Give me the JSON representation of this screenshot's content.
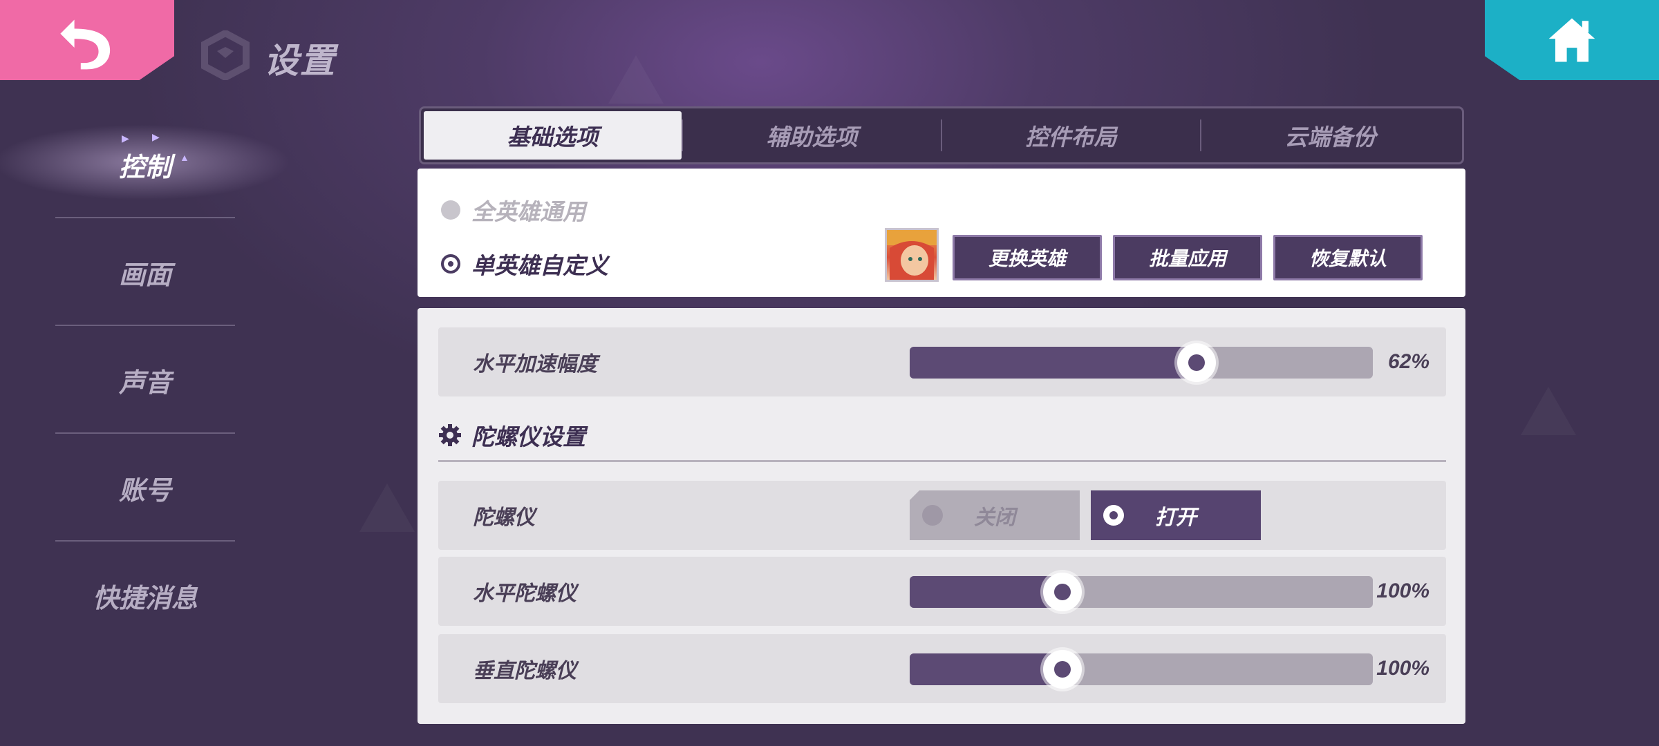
{
  "header": {
    "title": "设置",
    "back_icon": "back-arrow-icon",
    "home_icon": "home-icon",
    "colors": {
      "back": "#f06aa6",
      "home": "#1cb0c6"
    }
  },
  "nav": {
    "items": [
      {
        "label": "控制",
        "active": true
      },
      {
        "label": "画面",
        "active": false
      },
      {
        "label": "声音",
        "active": false
      },
      {
        "label": "账号",
        "active": false
      },
      {
        "label": "快捷消息",
        "active": false
      }
    ]
  },
  "tabs": [
    {
      "label": "基础选项",
      "active": true
    },
    {
      "label": "辅助选项",
      "active": false
    },
    {
      "label": "控件布局",
      "active": false
    },
    {
      "label": "云端备份",
      "active": false
    }
  ],
  "hero_mode": {
    "option_all": "全英雄通用",
    "option_single": "单英雄自定义",
    "selected": "单英雄自定义",
    "buttons": {
      "change": "更换英雄",
      "batch": "批量应用",
      "reset": "恢复默认"
    }
  },
  "settings": {
    "horizontal_accel": {
      "label": "水平加速幅度",
      "value": "62%",
      "fraction": 0.62
    },
    "gyro_section_title": "陀螺仪设置",
    "gyro": {
      "label": "陀螺仪",
      "off_label": "关闭",
      "on_label": "打开",
      "state": "on"
    },
    "horizontal_gyro": {
      "label": "水平陀螺仪",
      "value": "100%",
      "fraction": 0.33
    },
    "vertical_gyro": {
      "label": "垂直陀螺仪",
      "value": "100%",
      "fraction": 0.33
    }
  }
}
